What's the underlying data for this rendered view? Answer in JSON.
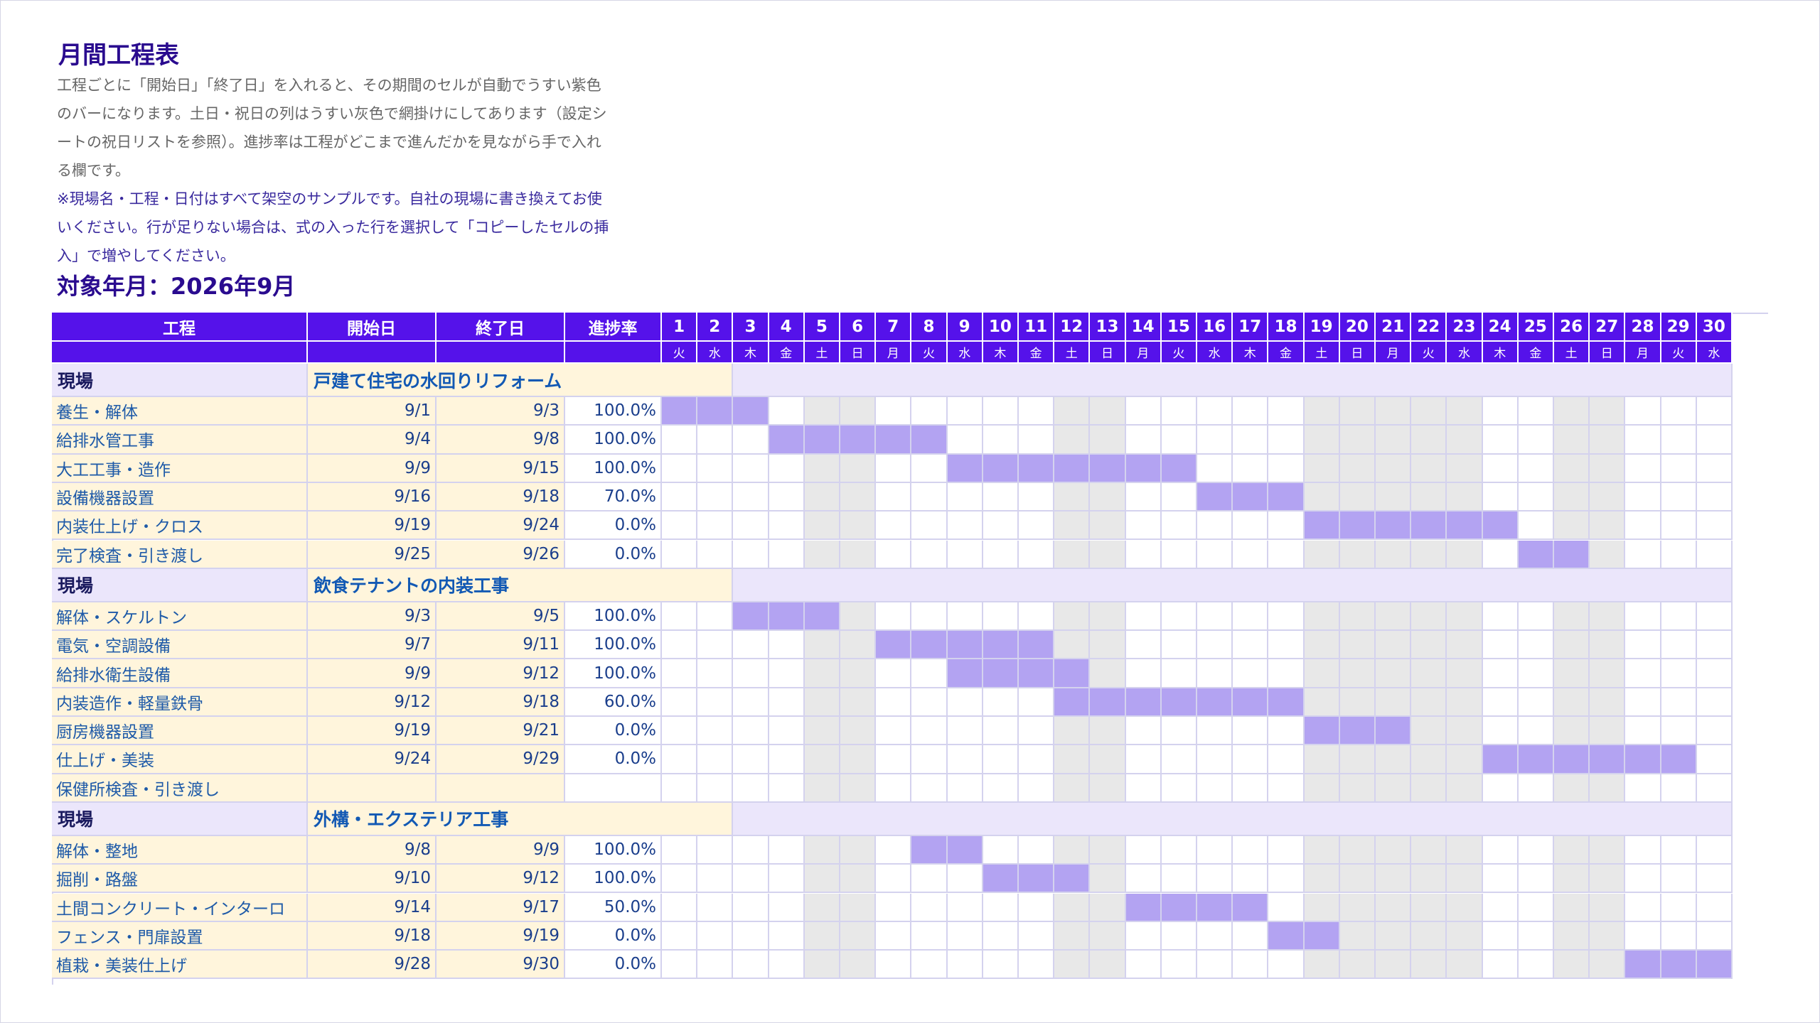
{
  "title": "月間工程表",
  "description_lines": [
    "工程ごとに「開始日」「終了日」を入れると、その期間のセルが自動でうすい紫色",
    "のバーになります。土日・祝日の列はうすい灰色で網掛けにしてあります（設定シ",
    "ートの祝日リストを参照）。進捗率は工程がどこまで進んだかを見ながら手で入れ",
    "る欄です。"
  ],
  "note_lines": [
    "※現場名・工程・日付はすべて架空のサンプルです。自社の現場に書き換えてお使",
    "いください。行が足りない場合は、式の入った行を選択して「コピーしたセルの挿",
    "入」で増やしてください。"
  ],
  "target_month": "対象年月：2026年9月",
  "headers": {
    "process": "工程",
    "start": "開始日",
    "end": "終了日",
    "progress": "進捗率"
  },
  "days": [
    "1",
    "2",
    "3",
    "4",
    "5",
    "6",
    "7",
    "8",
    "9",
    "10",
    "11",
    "12",
    "13",
    "14",
    "15",
    "16",
    "17",
    "18",
    "19",
    "20",
    "21",
    "22",
    "23",
    "24",
    "25",
    "26",
    "27",
    "28",
    "29",
    "30"
  ],
  "weekdays": [
    "火",
    "水",
    "木",
    "金",
    "土",
    "日",
    "月",
    "火",
    "水",
    "木",
    "金",
    "土",
    "日",
    "月",
    "火",
    "水",
    "木",
    "金",
    "土",
    "日",
    "月",
    "火",
    "水",
    "木",
    "金",
    "土",
    "日",
    "月",
    "火",
    "水"
  ],
  "off_days": [
    5,
    6,
    12,
    13,
    19,
    20,
    21,
    22,
    23,
    26,
    27
  ],
  "section_label": "現場",
  "sections": [
    {
      "name": "戸建て住宅の水回りリフォーム",
      "tasks": [
        {
          "name": "養生・解体",
          "start": "9/1",
          "end": "9/3",
          "progress": "100.0%",
          "s": 1,
          "e": 3
        },
        {
          "name": "給排水管工事",
          "start": "9/4",
          "end": "9/8",
          "progress": "100.0%",
          "s": 4,
          "e": 8
        },
        {
          "name": "大工工事・造作",
          "start": "9/9",
          "end": "9/15",
          "progress": "100.0%",
          "s": 9,
          "e": 15
        },
        {
          "name": "設備機器設置",
          "start": "9/16",
          "end": "9/18",
          "progress": "70.0%",
          "s": 16,
          "e": 18
        },
        {
          "name": "内装仕上げ・クロス",
          "start": "9/19",
          "end": "9/24",
          "progress": "0.0%",
          "s": 19,
          "e": 24
        },
        {
          "name": "完了検査・引き渡し",
          "start": "9/25",
          "end": "9/26",
          "progress": "0.0%",
          "s": 25,
          "e": 26
        }
      ]
    },
    {
      "name": "飲食テナントの内装工事",
      "tasks": [
        {
          "name": "解体・スケルトン",
          "start": "9/3",
          "end": "9/5",
          "progress": "100.0%",
          "s": 3,
          "e": 5
        },
        {
          "name": "電気・空調設備",
          "start": "9/7",
          "end": "9/11",
          "progress": "100.0%",
          "s": 7,
          "e": 11
        },
        {
          "name": "給排水衛生設備",
          "start": "9/9",
          "end": "9/12",
          "progress": "100.0%",
          "s": 9,
          "e": 12
        },
        {
          "name": "内装造作・軽量鉄骨",
          "start": "9/12",
          "end": "9/18",
          "progress": "60.0%",
          "s": 12,
          "e": 18
        },
        {
          "name": "厨房機器設置",
          "start": "9/19",
          "end": "9/21",
          "progress": "0.0%",
          "s": 19,
          "e": 21
        },
        {
          "name": "仕上げ・美装",
          "start": "9/24",
          "end": "9/29",
          "progress": "0.0%",
          "s": 24,
          "e": 29
        },
        {
          "name": "保健所検査・引き渡し",
          "start": "",
          "end": "",
          "progress": "",
          "s": 0,
          "e": 0
        }
      ]
    },
    {
      "name": "外構・エクステリア工事",
      "tasks": [
        {
          "name": "解体・整地",
          "start": "9/8",
          "end": "9/9",
          "progress": "100.0%",
          "s": 8,
          "e": 9
        },
        {
          "name": "掘削・路盤",
          "start": "9/10",
          "end": "9/12",
          "progress": "100.0%",
          "s": 10,
          "e": 12
        },
        {
          "name": "土間コンクリート・インターロ",
          "start": "9/14",
          "end": "9/17",
          "progress": "50.0%",
          "s": 14,
          "e": 17
        },
        {
          "name": "フェンス・門扉設置",
          "start": "9/18",
          "end": "9/19",
          "progress": "0.0%",
          "s": 18,
          "e": 19
        },
        {
          "name": "植栽・美装仕上げ",
          "start": "9/28",
          "end": "9/30",
          "progress": "0.0%",
          "s": 28,
          "e": 30
        }
      ]
    }
  ],
  "colors": {
    "header": "#5512ea",
    "bar": "#b3a3f2",
    "off_day": "#e8e8e8",
    "input_cell": "#fff5dc",
    "section_row": "#ebe6fb"
  }
}
